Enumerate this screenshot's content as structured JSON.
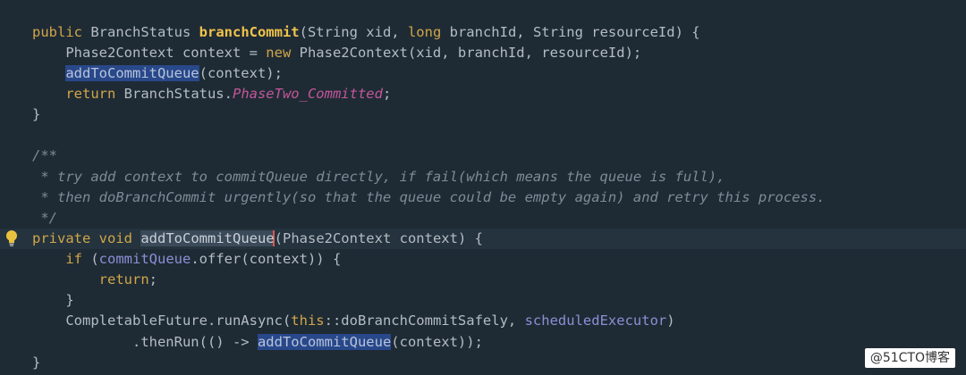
{
  "editor": {
    "colors": {
      "background": "#1f2b34",
      "keyword": "#d0a64a",
      "method_decl": "#f0c34c",
      "plain": "#b4bcc5",
      "constant": "#c2569b",
      "comment": "#7e8a95",
      "field": "#8c8fd6",
      "selection": "#28488a"
    },
    "gutter_icon": "lightbulb-icon",
    "code": {
      "l1": {
        "kw_public": "public",
        "type": " BranchStatus ",
        "method": "branchCommit",
        "args_a": "(String xid, ",
        "kw_long": "long",
        "args_b": " branchId, String resourceId) {"
      },
      "l2": {
        "decl": "    Phase2Context context = ",
        "kw_new": "new",
        "ctor": " Phase2Context(xid, branchId, resourceId);"
      },
      "l3": {
        "indent": "    ",
        "call": "addToCommitQueue",
        "rest": "(context);"
      },
      "l4": {
        "indent": "    ",
        "kw_return": "return",
        "type": " BranchStatus.",
        "constant": "PhaseTwo_Committed",
        "semi": ";"
      },
      "l5": "}",
      "l6": "/**",
      "l7": " * try add context to commitQueue directly, if fail(which means the queue is full),",
      "l8": " * then doBranchCommit urgently(so that the queue could be empty again) and retry this process.",
      "l9": " */",
      "l10": {
        "kw_private": "private",
        "sp": " ",
        "kw_void": "void",
        "sp2": " ",
        "method": "addToCommitQueue",
        "args": "(Phase2Context context) {"
      },
      "l11": {
        "indent": "    ",
        "kw_if": "if",
        "open": " (",
        "field": "commitQueue",
        "rest": ".offer(context)) {"
      },
      "l12": {
        "indent": "        ",
        "kw_return": "return",
        "semi": ";"
      },
      "l13": "    }",
      "l14": {
        "pre": "    CompletableFuture.runAsync(",
        "kw_this": "this",
        "ref": "::doBranchCommitSafely, ",
        "field": "scheduledExecutor",
        "close": ")"
      },
      "l15": {
        "pre": "            .thenRun(() -> ",
        "call": "addToCommitQueue",
        "rest": "(context));"
      },
      "l16": "}"
    }
  },
  "watermark": {
    "text": "@51CTO博客"
  }
}
